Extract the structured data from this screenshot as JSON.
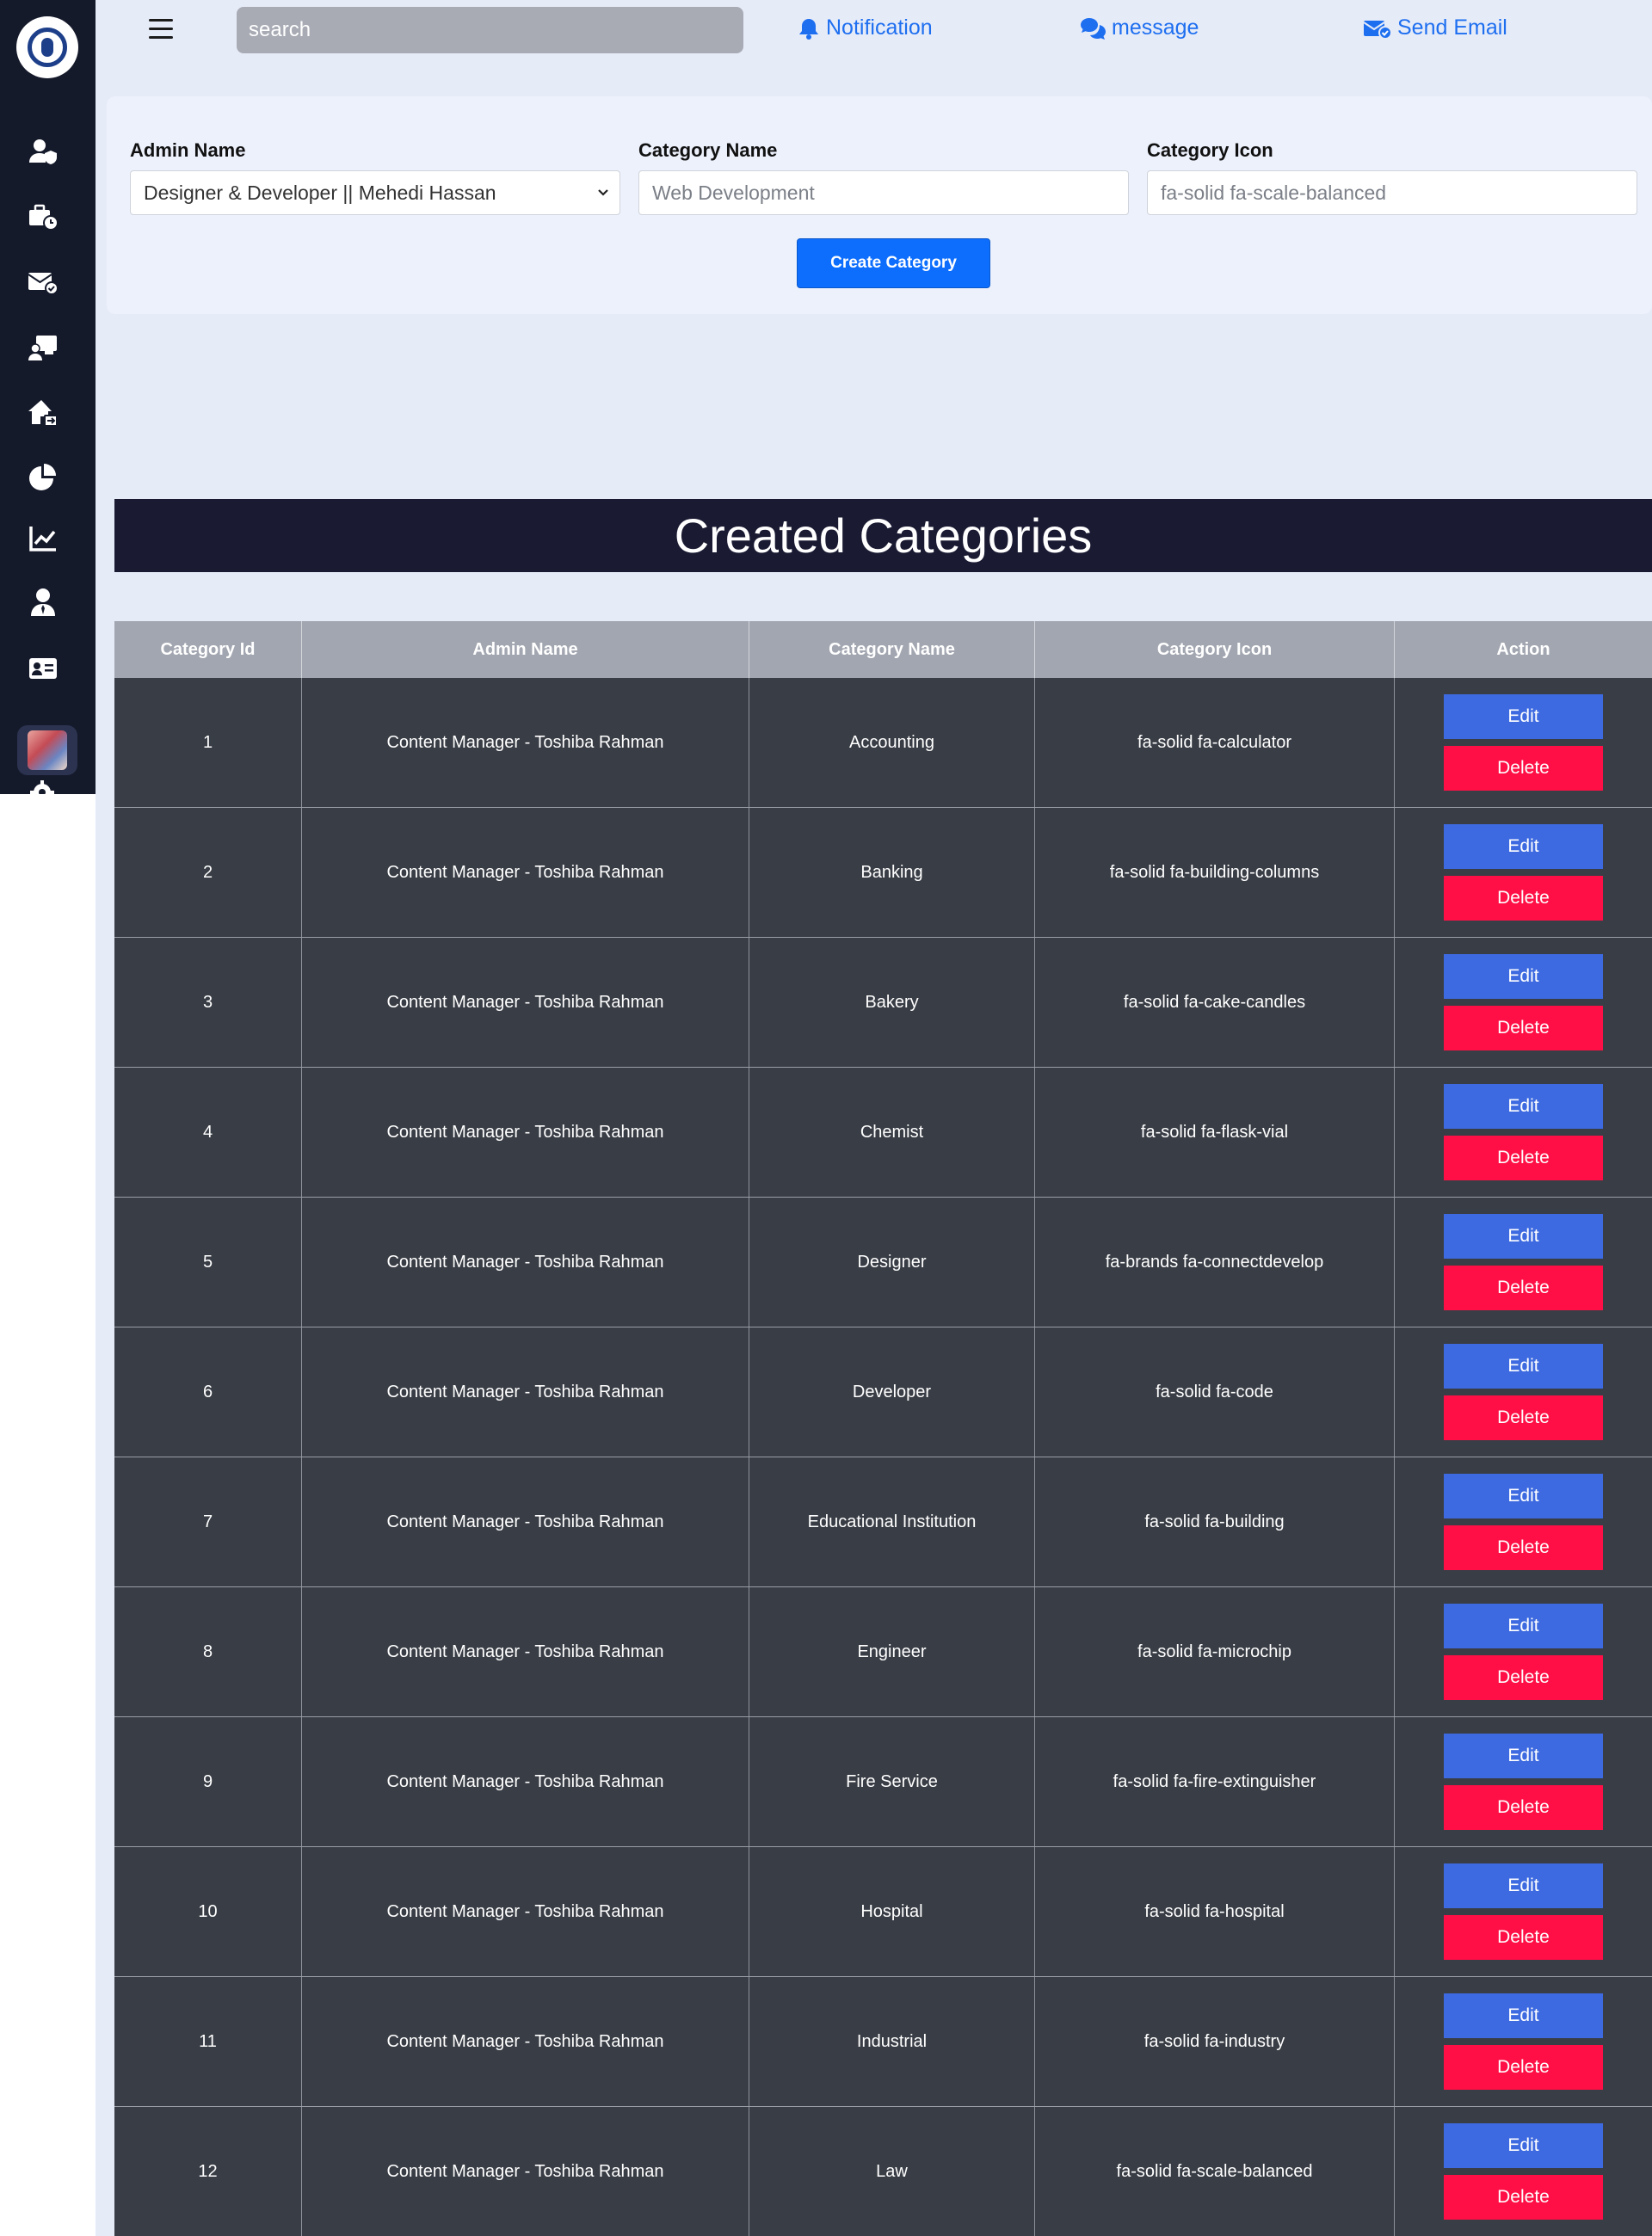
{
  "sidebar": {
    "items": [
      {
        "icon": "user-shield-icon"
      },
      {
        "icon": "briefcase-clock-icon"
      },
      {
        "icon": "envelope-check-icon"
      },
      {
        "icon": "chalkboard-user-icon"
      },
      {
        "icon": "house-arrow-icon"
      },
      {
        "icon": "chart-pie-icon"
      },
      {
        "icon": "chart-line-icon"
      },
      {
        "icon": "user-tie-icon"
      },
      {
        "icon": "id-card-icon"
      }
    ]
  },
  "topbar": {
    "search_placeholder": "search",
    "notification_label": "Notification",
    "message_label": "message",
    "send_email_label": "Send Email"
  },
  "form": {
    "admin_label": "Admin Name",
    "admin_value": "Designer & Developer || Mehedi Hassan",
    "category_label": "Category Name",
    "category_placeholder": "Web Development",
    "icon_label": "Category Icon",
    "icon_placeholder": "fa-solid fa-scale-balanced",
    "create_button": "Create Category"
  },
  "section_title": "Created Categories",
  "table": {
    "headers": [
      "Category Id",
      "Admin Name",
      "Category Name",
      "Category Icon",
      "Action"
    ],
    "edit_label": "Edit",
    "delete_label": "Delete",
    "rows": [
      {
        "id": "1",
        "admin": "Content Manager - Toshiba Rahman",
        "name": "Accounting",
        "icon": "fa-solid fa-calculator"
      },
      {
        "id": "2",
        "admin": "Content Manager - Toshiba Rahman",
        "name": "Banking",
        "icon": "fa-solid fa-building-columns"
      },
      {
        "id": "3",
        "admin": "Content Manager - Toshiba Rahman",
        "name": "Bakery",
        "icon": "fa-solid fa-cake-candles"
      },
      {
        "id": "4",
        "admin": "Content Manager - Toshiba Rahman",
        "name": "Chemist",
        "icon": "fa-solid fa-flask-vial"
      },
      {
        "id": "5",
        "admin": "Content Manager - Toshiba Rahman",
        "name": "Designer",
        "icon": "fa-brands fa-connectdevelop"
      },
      {
        "id": "6",
        "admin": "Content Manager - Toshiba Rahman",
        "name": "Developer",
        "icon": "fa-solid fa-code"
      },
      {
        "id": "7",
        "admin": "Content Manager - Toshiba Rahman",
        "name": "Educational Institution",
        "icon": "fa-solid fa-building"
      },
      {
        "id": "8",
        "admin": "Content Manager - Toshiba Rahman",
        "name": "Engineer",
        "icon": "fa-solid fa-microchip"
      },
      {
        "id": "9",
        "admin": "Content Manager - Toshiba Rahman",
        "name": "Fire Service",
        "icon": "fa-solid fa-fire-extinguisher"
      },
      {
        "id": "10",
        "admin": "Content Manager - Toshiba Rahman",
        "name": "Hospital",
        "icon": "fa-solid fa-hospital"
      },
      {
        "id": "11",
        "admin": "Content Manager - Toshiba Rahman",
        "name": "Industrial",
        "icon": "fa-solid fa-industry"
      },
      {
        "id": "12",
        "admin": "Content Manager - Toshiba Rahman",
        "name": "Law",
        "icon": "fa-solid fa-scale-balanced"
      }
    ]
  },
  "colors": {
    "sidebar": "#151a2b",
    "accent": "#0d6efd",
    "edit": "#3d6ae0",
    "delete": "#ff0f45",
    "banner": "#1a1a33",
    "row": "#393d45"
  }
}
